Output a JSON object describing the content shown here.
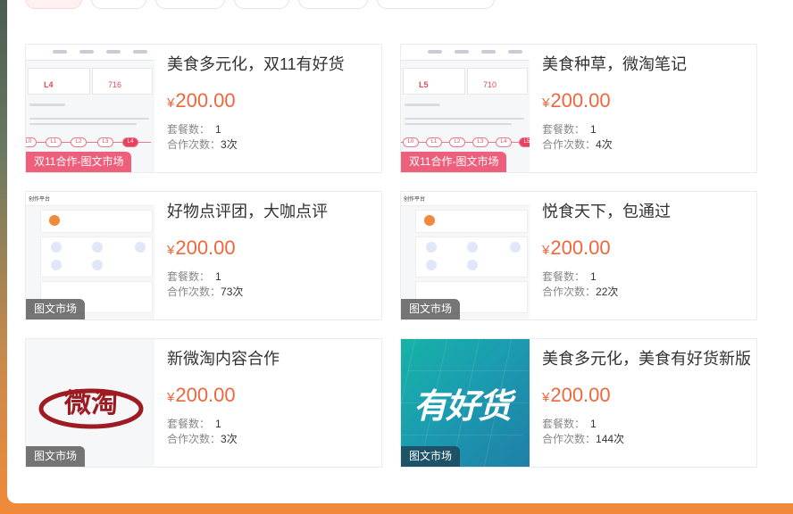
{
  "colors": {
    "accent_price": "#f0663c",
    "tag_pink": "#ee5f7c",
    "tag_gray": "#505050"
  },
  "labels": {
    "package_count": "套餐数：",
    "coop_count": "合作次数：",
    "currency": "¥"
  },
  "cards": [
    {
      "title": "美食多元化，双11有好货",
      "price": "200.00",
      "package_count": "1",
      "coop_count": "3次",
      "tag": "双11合作-图文市场",
      "thumb_level": "L4",
      "thumb_value": "716"
    },
    {
      "title": "美食种草，微淘笔记",
      "price": "200.00",
      "package_count": "1",
      "coop_count": "4次",
      "tag": "双11合作-图文市场",
      "thumb_level": "L5",
      "thumb_value": "710"
    },
    {
      "title": "好物点评团，大咖点评",
      "price": "200.00",
      "package_count": "1",
      "coop_count": "73次",
      "tag": "图文市场",
      "thumb_brand": "创作平台"
    },
    {
      "title": "悦食天下，包通过",
      "price": "200.00",
      "package_count": "1",
      "coop_count": "22次",
      "tag": "图文市场",
      "thumb_brand": "创作平台"
    },
    {
      "title": "新微淘内容合作",
      "price": "200.00",
      "package_count": "1",
      "coop_count": "3次",
      "tag": "图文市场",
      "thumb_logo": "微淘"
    },
    {
      "title": "美食多元化，美食有好货新版",
      "price": "200.00",
      "package_count": "1",
      "coop_count": "144次",
      "tag": "图文市场",
      "thumb_logo": "有好货"
    }
  ]
}
